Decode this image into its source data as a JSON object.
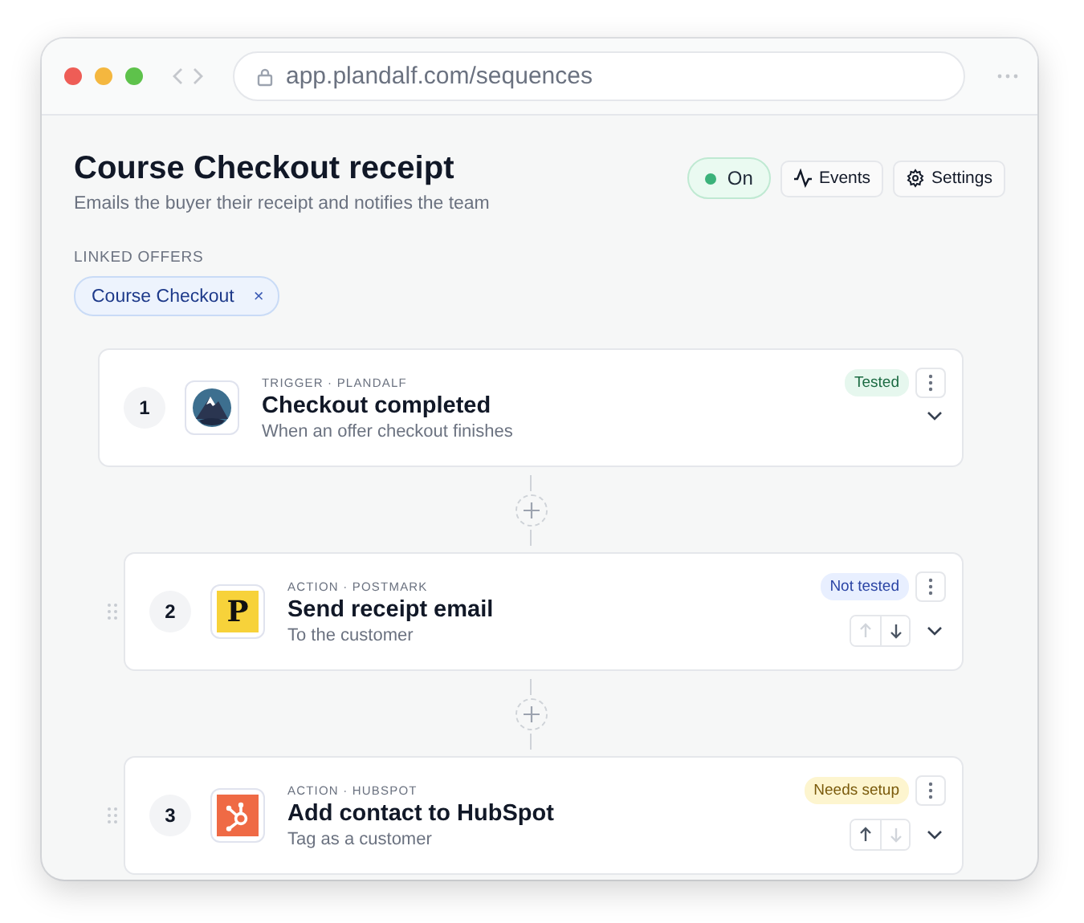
{
  "browser": {
    "url": "app.plandalf.com/sequences"
  },
  "header": {
    "title": "Course Checkout receipt",
    "subtitle": "Emails the buyer their receipt and notifies the team",
    "toggle": {
      "label": "On",
      "on": true
    },
    "buttons": [
      {
        "kind": "events",
        "label": "Events"
      },
      {
        "kind": "settings",
        "label": "Settings"
      }
    ]
  },
  "linked_offers": {
    "label": "LINKED OFFERS",
    "chips": [
      {
        "label": "Course Checkout",
        "remove": "×"
      }
    ]
  },
  "steps": [
    {
      "kind": "trigger",
      "number": "1",
      "category": "TRIGGER · PLANDALF",
      "title": "Checkout completed",
      "subtitle": "When an offer checkout finishes",
      "status": {
        "kind": "tested",
        "label": "Tested"
      }
    },
    {
      "kind": "action",
      "number": "2",
      "category": "ACTION · POSTMARK",
      "title": "Send receipt email",
      "subtitle": "To the customer",
      "logo_text": "P",
      "status": {
        "kind": "not_tested",
        "label": "Not tested"
      },
      "move_up_disabled": true,
      "move_down_disabled": false
    },
    {
      "kind": "action",
      "number": "3",
      "category": "ACTION · HUBSPOT",
      "title": "Add contact to HubSpot",
      "subtitle": "Tag as a customer",
      "status": {
        "kind": "needs_setup",
        "label": "Needs setup"
      },
      "move_up_disabled": false,
      "move_down_disabled": true
    }
  ]
}
